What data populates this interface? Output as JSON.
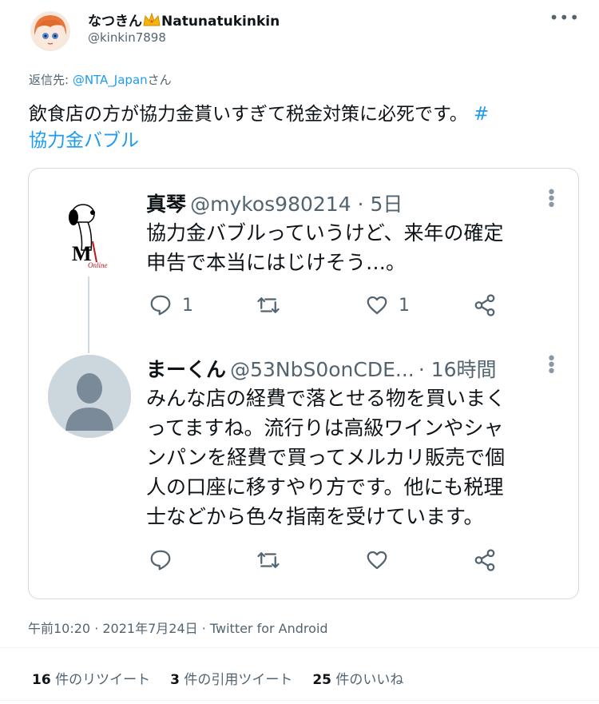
{
  "author": {
    "display_name_before": "なつきん",
    "crown_icon": "crown-icon",
    "display_name_after": "Natunatukinkin",
    "handle": "@kinkin7898"
  },
  "reply_to": {
    "prefix": "返信先: ",
    "target": "@NTA_Japan",
    "suffix": "さん"
  },
  "tweet": {
    "text_line1": "飲食店の方が協力金貰いすぎて税金対策に必死です。",
    "hashtag_hash": "#",
    "hashtag_line2": "協力金バブル"
  },
  "embedded": {
    "tweet1": {
      "name": "真琴",
      "handle_time": "@mykos980214 · 5日",
      "line1": "協力金バブルっていうけど、来年の確定",
      "line2": "申告で本当にはじけそう…。",
      "reply_count": "1",
      "like_count": "1"
    },
    "tweet2": {
      "name": "まーくん",
      "handle": "@53NbS0onCDE...",
      "time": "· 16時間",
      "line1": "みんな店の経費で落とせる物を買いまく",
      "line2": "ってますね。流行りは高級ワインやシャ",
      "line3": "ンパンを経費で買ってメルカリ販売で個",
      "line4": "人の口座に移すやり方です。他にも税理",
      "line5": "士などから色々指南を受けています。"
    }
  },
  "meta": "午前10:20 · 2021年7月24日 · Twitter for Android",
  "stats": {
    "retweets_num": "16",
    "retweets_label": " 件のリツイート",
    "quotes_num": "3",
    "quotes_label": " 件の引用ツイート",
    "likes_num": "25",
    "likes_label": " 件のいいね"
  },
  "colors": {
    "link": "#1d9bf0",
    "muted": "#536471",
    "border": "#cfd9de"
  }
}
